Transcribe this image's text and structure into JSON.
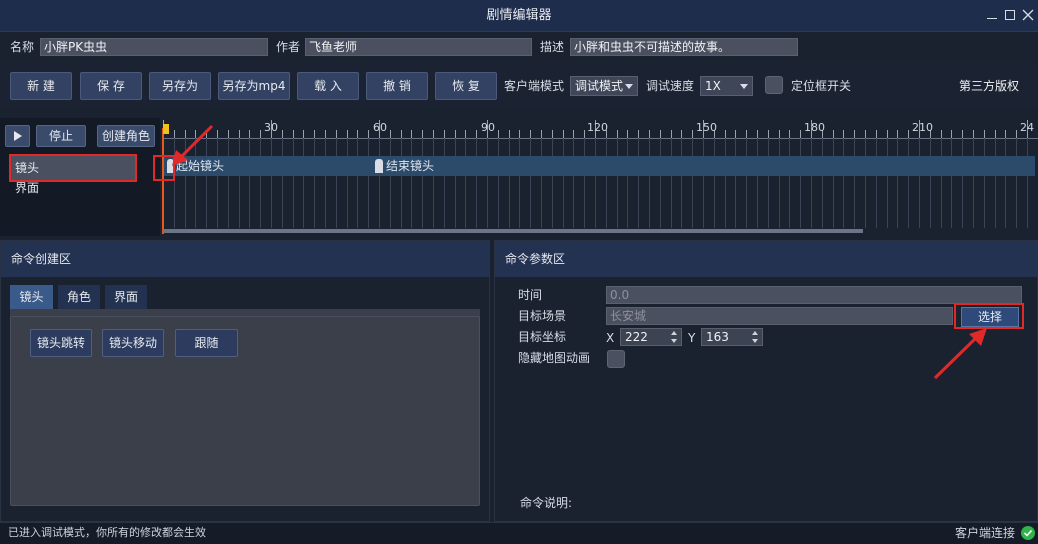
{
  "window": {
    "title": "剧情编辑器"
  },
  "info": {
    "name_label": "名称",
    "name_value": "小胖PK虫虫",
    "author_label": "作者",
    "author_value": "飞鱼老师",
    "desc_label": "描述",
    "desc_value": "小胖和虫虫不可描述的故事。"
  },
  "toolbar": {
    "new_label": "新 建",
    "save_label": "保 存",
    "save_as_label": "另存为",
    "save_as_mp4_label": "另存为mp4",
    "load_label": "载 入",
    "undo_label": "撤 销",
    "redo_label": "恢 复",
    "client_mode_label": "客户端模式",
    "client_mode_value": "调试模式",
    "debug_speed_label": "调试速度",
    "debug_speed_value": "1X",
    "locator_toggle_label": "定位框开关",
    "copyright_label": "第三方版权"
  },
  "timeline": {
    "stop_label": "停止",
    "create_role_label": "创建角色",
    "tracks": [
      "镜头",
      "界面"
    ],
    "ticks": [
      "30",
      "60",
      "90",
      "120",
      "150",
      "180",
      "210",
      "24"
    ],
    "events": [
      "起始镜头",
      "结束镜头"
    ]
  },
  "command_create": {
    "title": "命令创建区",
    "tabs": [
      "镜头",
      "角色",
      "界面"
    ],
    "buttons": [
      "镜头跳转",
      "镜头移动",
      "跟随"
    ]
  },
  "command_params": {
    "title": "命令参数区",
    "time_label": "时间",
    "time_value": "0.0",
    "target_scene_label": "目标场景",
    "target_scene_value": "长安城",
    "select_label": "选择",
    "target_coord_label": "目标坐标",
    "x_label": "X",
    "x_value": "222",
    "y_label": "Y",
    "y_value": "163",
    "hide_map_anim_label": "隐藏地图动画",
    "description_label": "命令说明:"
  },
  "status": {
    "message": "已进入调试模式，你所有的修改都会生效",
    "client_connection": "客户端连接"
  },
  "colors": {
    "title_bar": "#1f2d4d",
    "panel_header": "#243252",
    "annotation_red": "#e02a2a",
    "status_ok": "#2fb34a"
  }
}
